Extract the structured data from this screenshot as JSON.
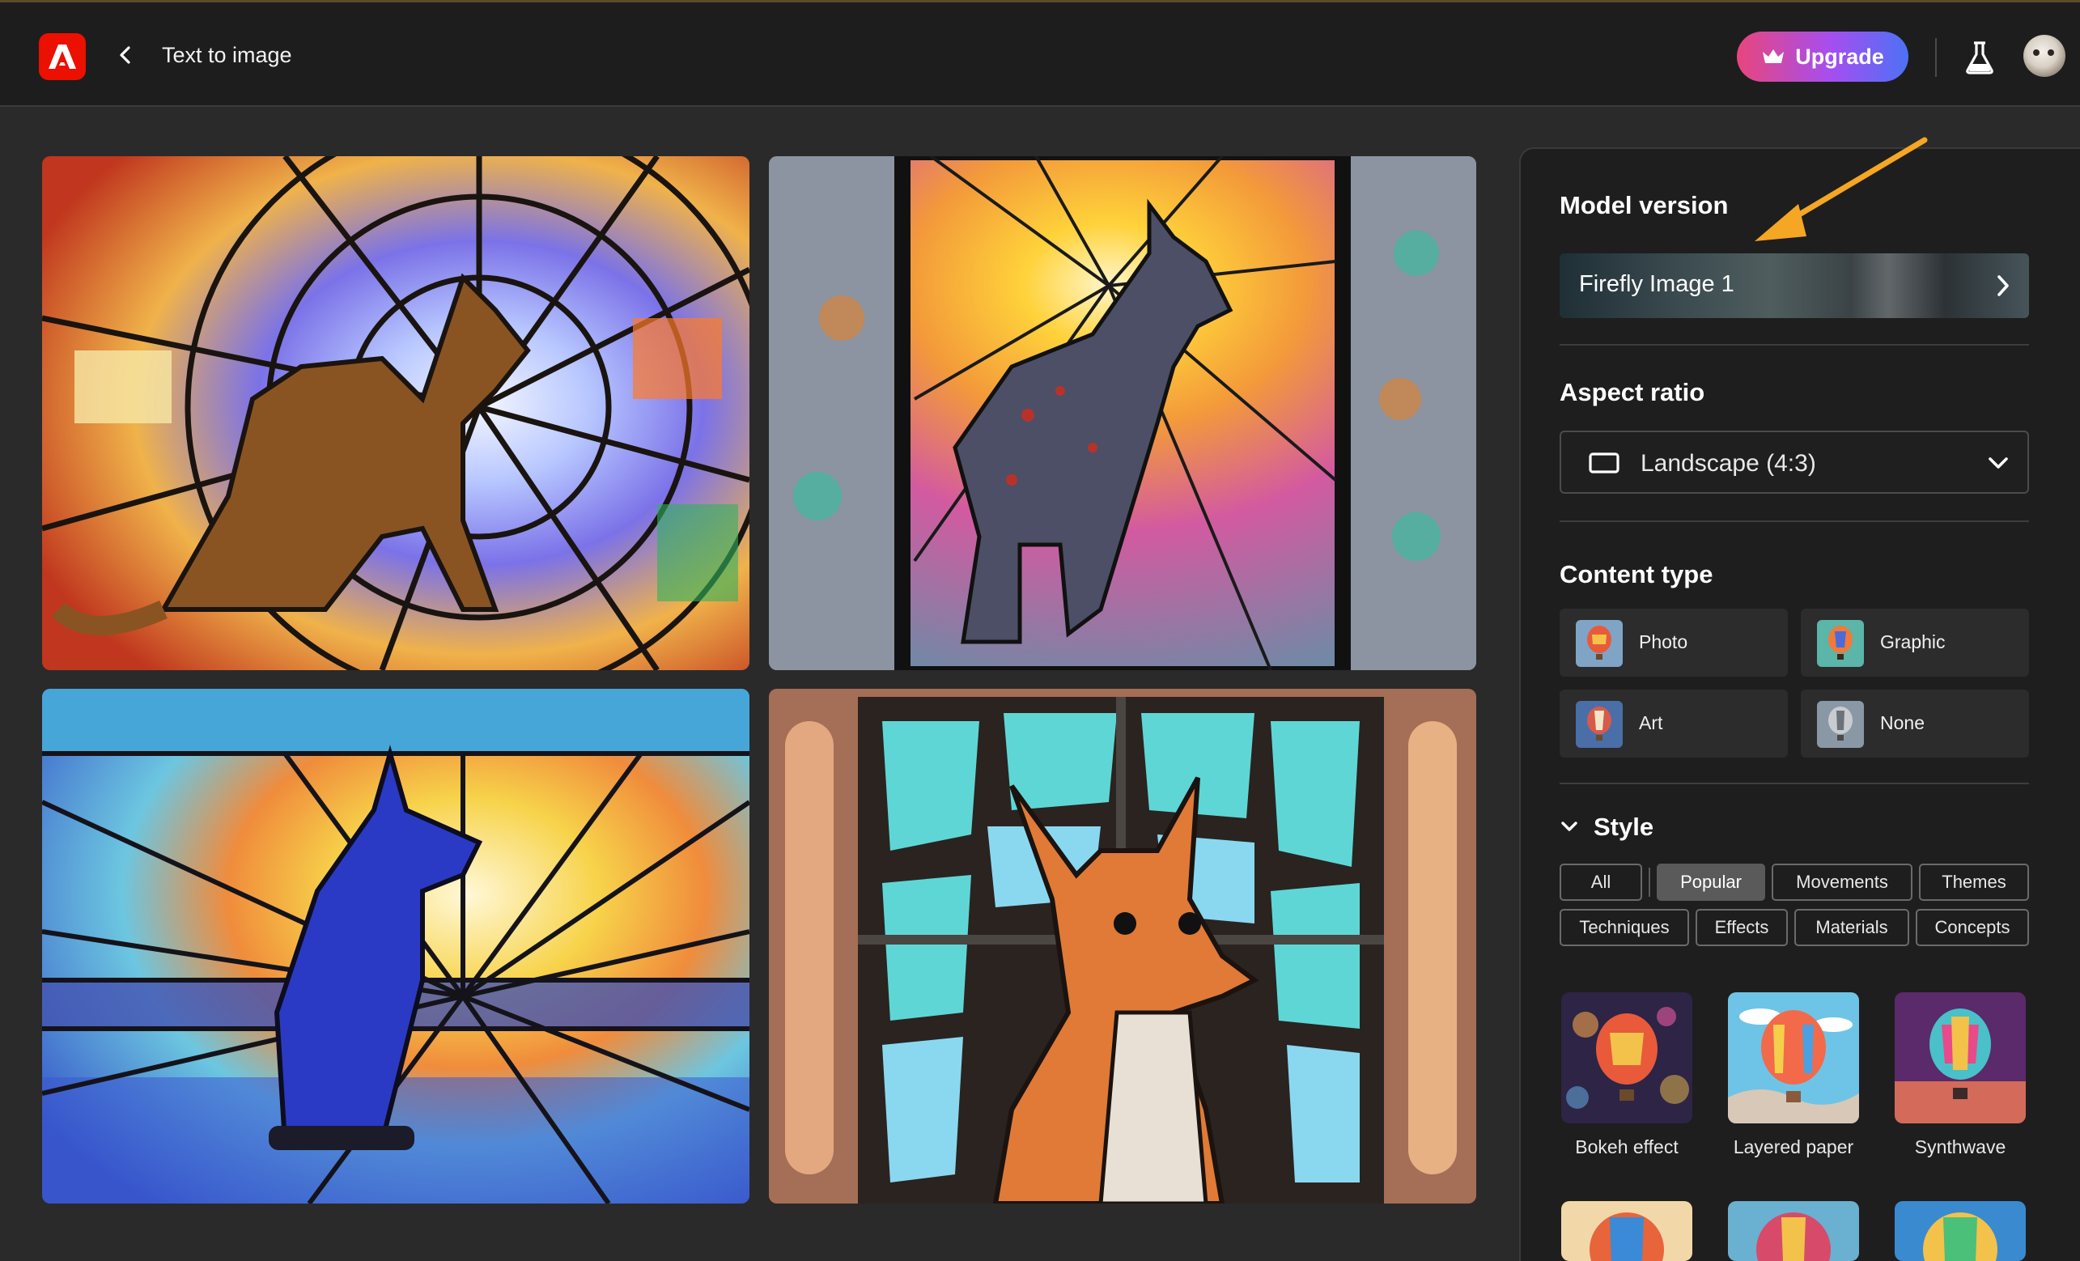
{
  "header": {
    "title": "Text to image",
    "upgrade_label": "Upgrade"
  },
  "panel": {
    "model_version": {
      "title": "Model version",
      "value": "Firefly Image 1"
    },
    "aspect_ratio": {
      "title": "Aspect ratio",
      "value": "Landscape (4:3)"
    },
    "content_type": {
      "title": "Content type",
      "options": [
        {
          "label": "Photo"
        },
        {
          "label": "Graphic"
        },
        {
          "label": "Art"
        },
        {
          "label": "None"
        }
      ]
    },
    "style": {
      "title": "Style",
      "filters": [
        {
          "label": "All"
        },
        {
          "label": "Popular",
          "active": true
        },
        {
          "label": "Movements"
        },
        {
          "label": "Themes"
        },
        {
          "label": "Techniques"
        },
        {
          "label": "Effects"
        },
        {
          "label": "Materials"
        },
        {
          "label": "Concepts"
        }
      ],
      "items": [
        {
          "label": "Bokeh effect"
        },
        {
          "label": "Layered paper"
        },
        {
          "label": "Synthwave"
        }
      ]
    }
  },
  "colors": {
    "accent_arrow": "#f5a623",
    "logo_red": "#eb1000",
    "upgrade_gradient": [
      "#e8467c",
      "#a54ef0",
      "#4c72f5"
    ]
  }
}
